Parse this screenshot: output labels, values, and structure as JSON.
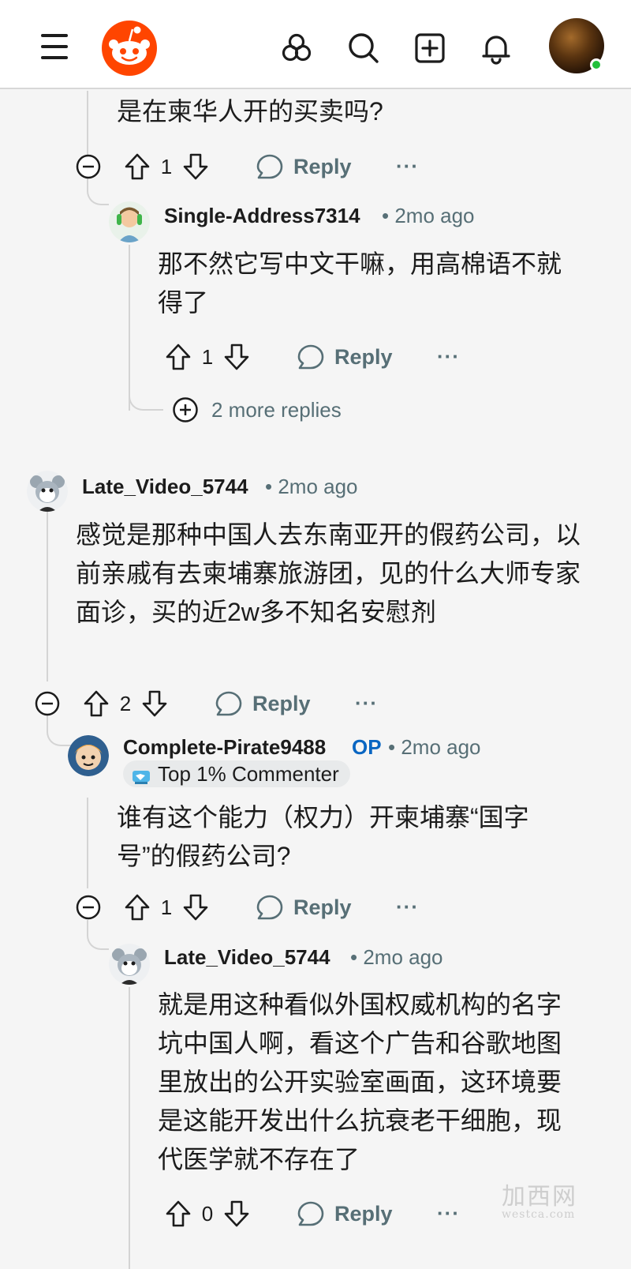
{
  "header": {
    "menu_icon": "hamburger-menu-icon",
    "logo": "reddit-snoo-logo",
    "icons": [
      "communities-icon",
      "search-icon",
      "create-post-icon",
      "notifications-icon"
    ],
    "avatar_status": "online"
  },
  "comments": [
    {
      "body": "是在柬华人开的买卖吗?",
      "score": "1",
      "reply_label": "Reply",
      "more_label": "···"
    },
    {
      "username": "Single-Address7314",
      "time": "• 2mo ago",
      "body": "那不然它写中文干嘛，用高棉语不就得了",
      "score": "1",
      "reply_label": "Reply",
      "more_label": "···",
      "more_replies": "2 more replies"
    },
    {
      "username": "Late_Video_5744",
      "time": "• 2mo ago",
      "body": "感觉是那种中国人去东南亚开的假药公司，以前亲戚有去柬埔寨旅游团，见的什么大师专家面诊，买的近2w多不知名安慰剂",
      "score": "2",
      "reply_label": "Reply",
      "more_label": "···"
    },
    {
      "username": "Complete-Pirate9488",
      "op": "OP",
      "time": "• 2mo ago",
      "flair": "Top 1% Commenter",
      "body": "谁有这个能力（权力）开柬埔寨“国字号”的假药公司?",
      "score": "1",
      "reply_label": "Reply",
      "more_label": "···"
    },
    {
      "username": "Late_Video_5744",
      "time": "• 2mo ago",
      "body": "就是用这种看似外国权威机构的名字坑中国人啊，看这个广告和谷歌地图里放出的公开实验室画面，这环境要是这能开发出什么抗衰老干细胞，现代医学就不存在了",
      "score": "0",
      "reply_label": "Reply",
      "more_label": "···"
    }
  ],
  "watermark": {
    "text": "加西网",
    "sub": "westca.com"
  },
  "colors": {
    "brand": "#ff4500",
    "meta": "#576f76",
    "op": "#0a66c2",
    "online": "#22c03a"
  }
}
